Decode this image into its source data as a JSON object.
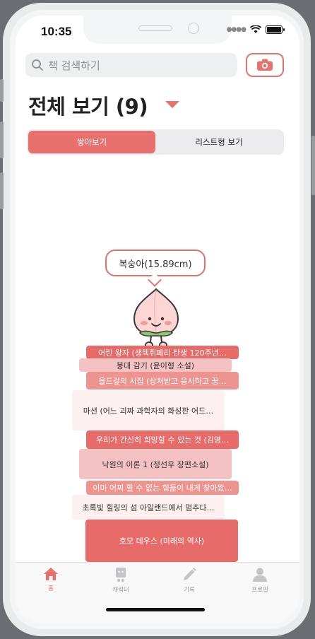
{
  "status_bar": {
    "time": "10:35"
  },
  "search": {
    "placeholder": "책 검색하기"
  },
  "header": {
    "title": "전체 보기 (9)"
  },
  "segmented": {
    "stack_label": "쌓아보기",
    "list_label": "리스트형 보기"
  },
  "stack": {
    "mascot_label": "복숭아(15.89cm)",
    "books": [
      {
        "title": "어린 왕자 (생텍쥐페리 탄생 120주년…",
        "color": "#e66b69"
      },
      {
        "title": "붕대 감기 (윤이형 소설)",
        "color": "#f4c2c2"
      },
      {
        "title": "올드걸의 시집 (상처받고 응시하고 꿈…",
        "color": "#ee9490"
      },
      {
        "title": "마션 (어느 괴짜 과학자의 화성판 어드…",
        "color": "#fdf0f0"
      },
      {
        "title": "우리가 간신히 희망할 수 있는 것 (김영…",
        "color": "#e66b69"
      },
      {
        "title": "낙원의 이론 1 (정선우 장편소설)",
        "color": "#f4c2c2"
      },
      {
        "title": "이미 어찌 할 수 없는 힘듦이 내게 찾아왔…",
        "color": "#ee9490"
      },
      {
        "title": "초록빛 힐링의 섬 아일랜드에서 멈추다…",
        "color": "#fdf0f0"
      },
      {
        "title": "호모 데우스 (미래의 역사)",
        "color": "#e66b69"
      }
    ]
  },
  "tabbar": {
    "items": [
      {
        "label": "홈",
        "icon": "home-icon",
        "active": true
      },
      {
        "label": "캐릭터",
        "icon": "character-icon",
        "active": false
      },
      {
        "label": "기록",
        "icon": "pencil-icon",
        "active": false
      },
      {
        "label": "프로필",
        "icon": "person-icon",
        "active": false
      }
    ]
  },
  "colors": {
    "accent": "#e8716e"
  }
}
